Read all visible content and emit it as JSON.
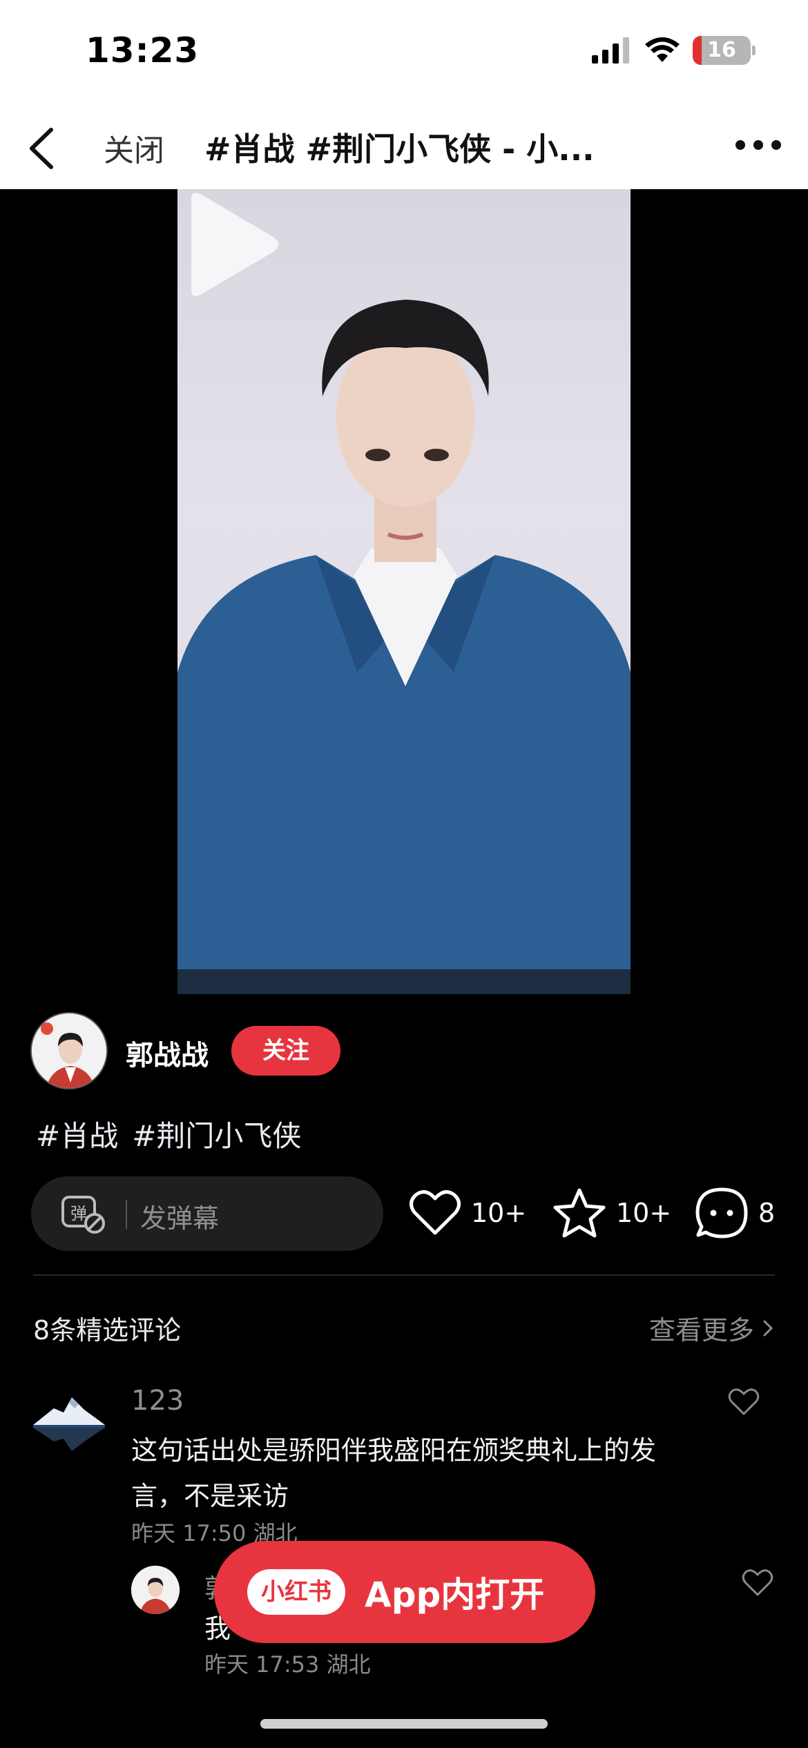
{
  "status_bar": {
    "time": "13:23",
    "battery_level": "16",
    "battery_fraction": 0.16,
    "icons": [
      "signal-icon",
      "wifi-icon",
      "battery-icon"
    ],
    "battery_color": "#e0302f"
  },
  "nav": {
    "back_icon": "chevron-left-icon",
    "close_label": "关闭",
    "title": "#肖战 #荆门小飞侠 - 小...",
    "more_icon": "ellipsis-icon"
  },
  "video": {
    "play_icon": "play-icon",
    "background_color": "#dcdae2"
  },
  "author": {
    "name": "郭战战",
    "follow_label": "关注",
    "accent_color": "#e7353f"
  },
  "post": {
    "tags": [
      "#肖战",
      "#荆门小飞侠"
    ]
  },
  "actions": {
    "danmaku_placeholder": "发弹幕",
    "danmaku_icon": "danmaku-toggle-icon",
    "like_count": "10+",
    "collect_count": "10+",
    "comment_count": "8"
  },
  "comments": {
    "header": "8条精选评论",
    "see_more": "查看更多",
    "items": [
      {
        "user": "123",
        "text": "这句话出处是骄阳伴我盛阳在颁奖典礼上的发言，不是采访",
        "time": "昨天 17:50",
        "location": "湖北",
        "reply": {
          "user": "郭",
          "text": "我",
          "time": "昨天 17:53",
          "location": "湖北"
        }
      }
    ]
  },
  "open_app": {
    "logo_text": "小红书",
    "label": "App内打开"
  }
}
